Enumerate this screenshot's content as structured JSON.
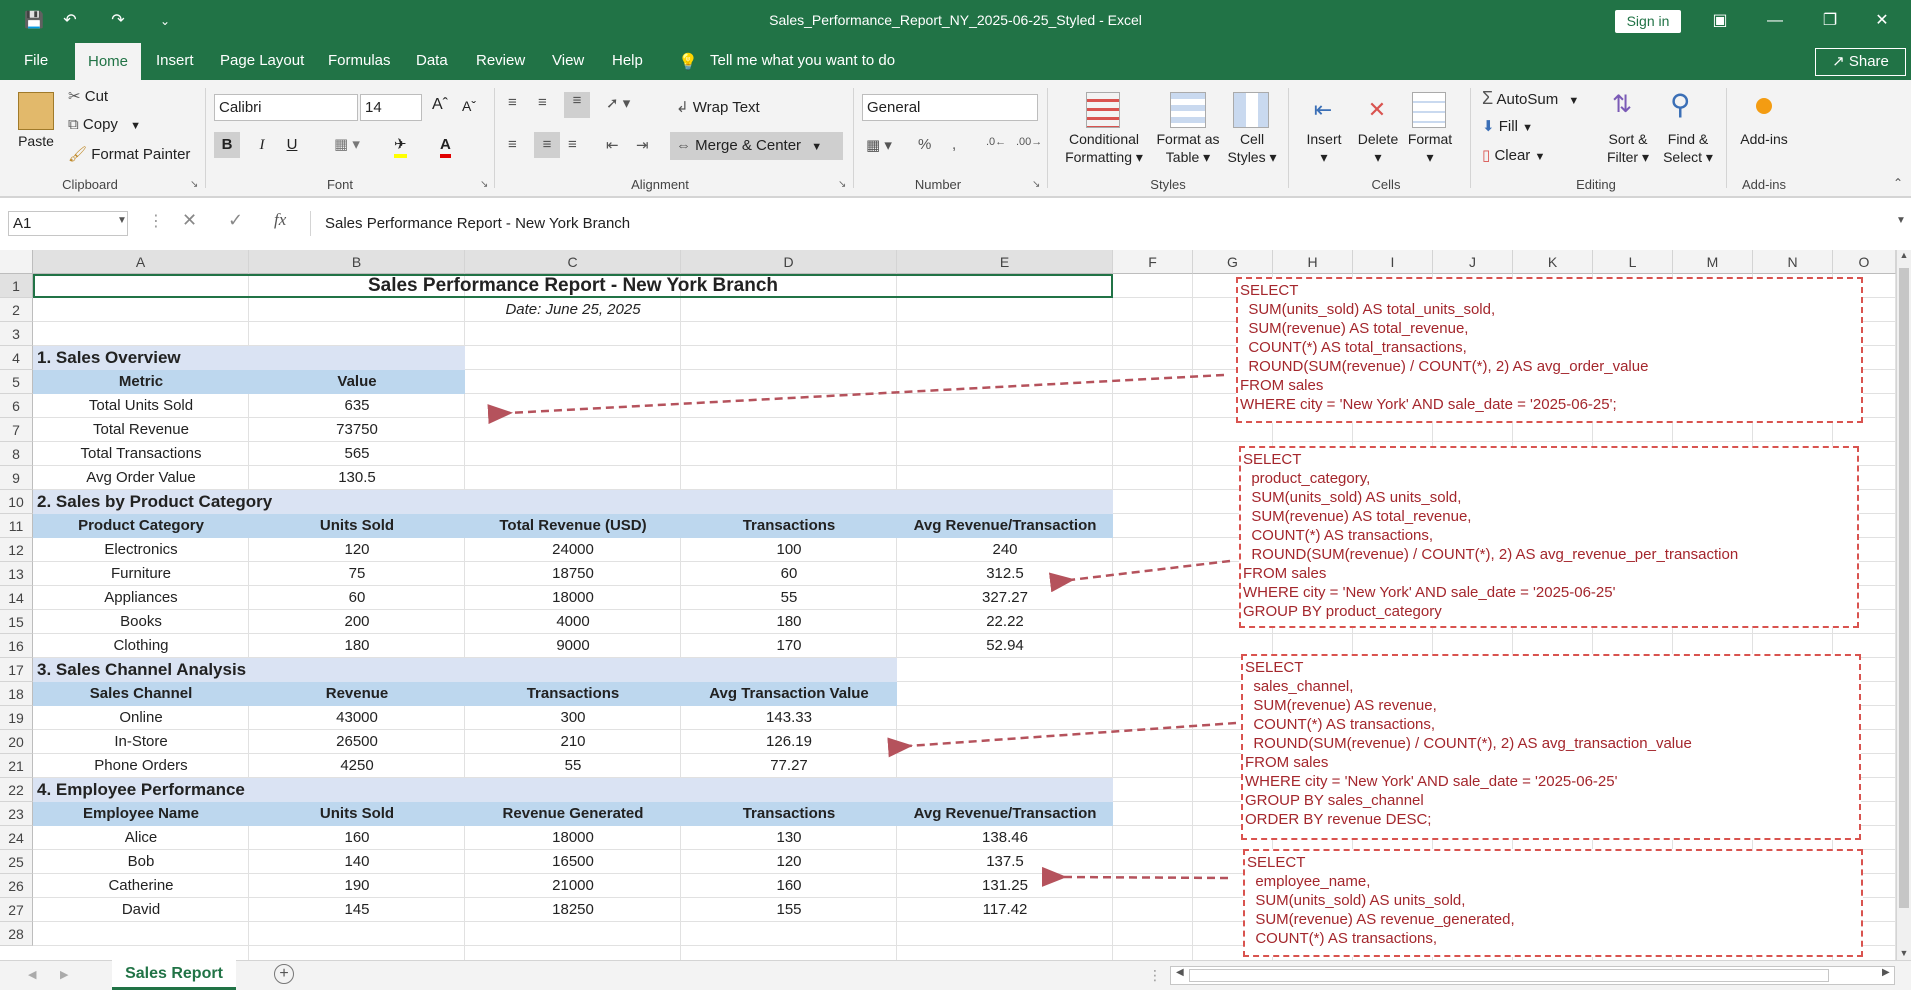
{
  "window": {
    "title": "Sales_Performance_Report_NY_2025-06-25_Styled  -  Excel",
    "signin": "Sign in"
  },
  "menu": {
    "file": "File",
    "home": "Home",
    "insert": "Insert",
    "page_layout": "Page Layout",
    "formulas": "Formulas",
    "data": "Data",
    "review": "Review",
    "view": "View",
    "help": "Help",
    "tell_me": "Tell me what you want to do",
    "share": "Share"
  },
  "ribbon": {
    "clipboard": {
      "label": "Clipboard",
      "paste": "Paste",
      "cut": "Cut",
      "copy": "Copy",
      "format_painter": "Format Painter"
    },
    "font": {
      "label": "Font",
      "name": "Calibri",
      "size": "14",
      "bold": "B",
      "italic": "I",
      "underline": "U"
    },
    "alignment": {
      "label": "Alignment",
      "wrap": "Wrap Text",
      "merge": "Merge & Center"
    },
    "number": {
      "label": "Number",
      "format": "General"
    },
    "styles": {
      "label": "Styles",
      "cond": "Conditional",
      "cond2": "Formatting",
      "fmt_table": "Format as",
      "fmt_table2": "Table",
      "cell_styles": "Cell",
      "cell_styles2": "Styles"
    },
    "cells": {
      "label": "Cells",
      "insert": "Insert",
      "delete": "Delete",
      "format": "Format"
    },
    "editing": {
      "label": "Editing",
      "autosum": "AutoSum",
      "fill": "Fill",
      "clear": "Clear",
      "sort": "Sort &",
      "sort2": "Filter",
      "find": "Find &",
      "find2": "Select"
    },
    "addins": {
      "label": "Add-ins",
      "addins": "Add-ins"
    }
  },
  "formula_bar": {
    "name_box": "A1",
    "fx": "fx",
    "content": "Sales Performance Report - New York Branch"
  },
  "columns": [
    "A",
    "B",
    "C",
    "D",
    "E",
    "F",
    "G",
    "H",
    "I",
    "J",
    "K",
    "L",
    "M",
    "N",
    "O"
  ],
  "rows": [
    "1",
    "2",
    "3",
    "4",
    "5",
    "6",
    "7",
    "8",
    "9",
    "10",
    "11",
    "12",
    "13",
    "14",
    "15",
    "16",
    "17",
    "18",
    "19",
    "20",
    "21",
    "22",
    "23",
    "24",
    "25",
    "26",
    "27",
    "28"
  ],
  "sheet": {
    "title": "Sales Performance Report - New York Branch",
    "date": "Date: June 25, 2025",
    "s1": {
      "title": "1. Sales Overview",
      "headers": [
        "Metric",
        "Value"
      ],
      "rows": [
        [
          "Total Units Sold",
          "635"
        ],
        [
          "Total Revenue",
          "73750"
        ],
        [
          "Total Transactions",
          "565"
        ],
        [
          "Avg Order Value",
          "130.5"
        ]
      ]
    },
    "s2": {
      "title": "2. Sales by Product Category",
      "headers": [
        "Product Category",
        "Units Sold",
        "Total Revenue (USD)",
        "Transactions",
        "Avg Revenue/Transaction"
      ],
      "rows": [
        [
          "Electronics",
          "120",
          "24000",
          "100",
          "240"
        ],
        [
          "Furniture",
          "75",
          "18750",
          "60",
          "312.5"
        ],
        [
          "Appliances",
          "60",
          "18000",
          "55",
          "327.27"
        ],
        [
          "Books",
          "200",
          "4000",
          "180",
          "22.22"
        ],
        [
          "Clothing",
          "180",
          "9000",
          "170",
          "52.94"
        ]
      ]
    },
    "s3": {
      "title": "3. Sales Channel Analysis",
      "headers": [
        "Sales Channel",
        "Revenue",
        "Transactions",
        "Avg Transaction Value"
      ],
      "rows": [
        [
          "Online",
          "43000",
          "300",
          "143.33"
        ],
        [
          "In-Store",
          "26500",
          "210",
          "126.19"
        ],
        [
          "Phone Orders",
          "4250",
          "55",
          "77.27"
        ]
      ]
    },
    "s4": {
      "title": "4. Employee Performance",
      "headers": [
        "Employee Name",
        "Units Sold",
        "Revenue Generated",
        "Transactions",
        "Avg Revenue/Transaction"
      ],
      "rows": [
        [
          "Alice",
          "160",
          "18000",
          "130",
          "138.46"
        ],
        [
          "Bob",
          "140",
          "16500",
          "120",
          "137.5"
        ],
        [
          "Catherine",
          "190",
          "21000",
          "160",
          "131.25"
        ],
        [
          "David",
          "145",
          "18250",
          "155",
          "117.42"
        ]
      ]
    }
  },
  "sql": [
    "SELECT\n  SUM(units_sold) AS total_units_sold,\n  SUM(revenue) AS total_revenue,\n  COUNT(*) AS total_transactions,\n  ROUND(SUM(revenue) / COUNT(*), 2) AS avg_order_value\nFROM sales\nWHERE city = 'New York' AND sale_date = '2025-06-25';",
    "SELECT\n  product_category,\n  SUM(units_sold) AS units_sold,\n  SUM(revenue) AS total_revenue,\n  COUNT(*) AS transactions,\n  ROUND(SUM(revenue) / COUNT(*), 2) AS avg_revenue_per_transaction\nFROM sales\nWHERE city = 'New York' AND sale_date = '2025-06-25'\nGROUP BY product_category",
    "SELECT\n  sales_channel,\n  SUM(revenue) AS revenue,\n  COUNT(*) AS transactions,\n  ROUND(SUM(revenue) / COUNT(*), 2) AS avg_transaction_value\nFROM sales\nWHERE city = 'New York' AND sale_date = '2025-06-25'\nGROUP BY sales_channel\nORDER BY revenue DESC;",
    "SELECT\n  employee_name,\n  SUM(units_sold) AS units_sold,\n  SUM(revenue) AS revenue_generated,\n  COUNT(*) AS transactions,"
  ],
  "sheet_tab": "Sales Report",
  "colors": {
    "accent": "#217346",
    "section_fill": "#dae3f3",
    "header_fill": "#bdd7ee",
    "sql_text": "#a4262c",
    "arrow": "#b5525c"
  }
}
